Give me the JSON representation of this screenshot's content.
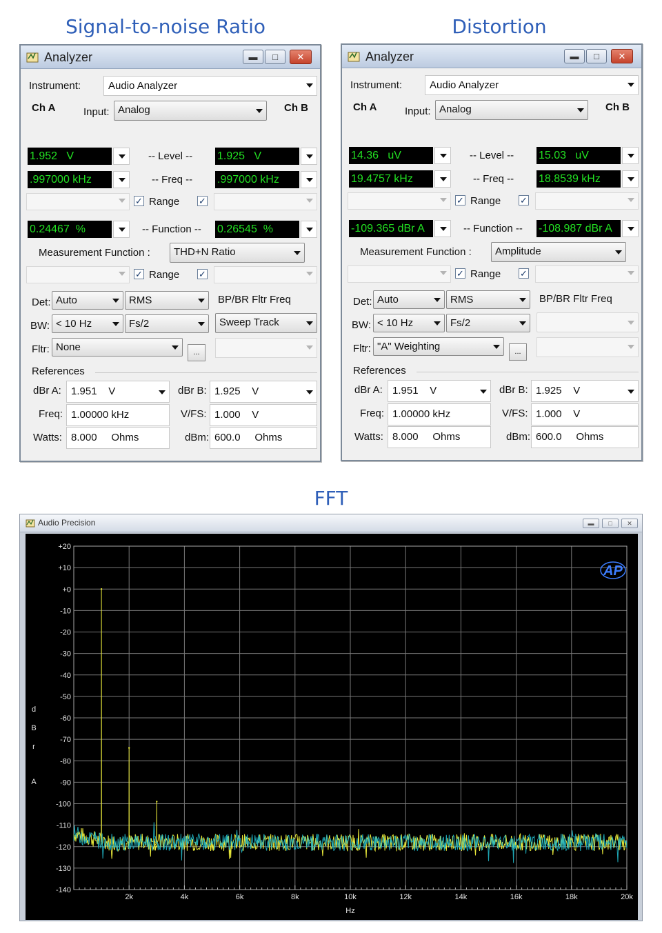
{
  "sections": {
    "snr": "Signal-to-noise Ratio",
    "distortion": "Distortion",
    "fft": "FFT"
  },
  "colors": {
    "section_title": "#2f5fb8",
    "meter_text": "#22e022",
    "meter_bg": "#000000",
    "trace_yellow": "#e8e83a",
    "trace_cyan": "#21b8c8",
    "logo": "#3c7dff"
  },
  "windows": [
    {
      "title": "Analyzer",
      "instrument_label": "Instrument:",
      "instrument_value": "Audio Analyzer",
      "ch_a": "Ch A",
      "ch_b": "Ch B",
      "input_label": "Input:",
      "input_value": "Analog",
      "level_a": "1.952   V",
      "level_label": "-- Level --",
      "level_b": "1.925   V",
      "freq_a": ".997000 kHz",
      "freq_label": "-- Freq --",
      "freq_b": ".997000 kHz",
      "range_label": "Range",
      "func_a": "0.24467  %",
      "func_label": "-- Function --",
      "func_b": "0.26545  %",
      "mf_label": "Measurement Function :",
      "mf_value": "THD+N Ratio",
      "det_label": "Det:",
      "det_value": "Auto",
      "det_value2": "RMS",
      "bp_label": "BP/BR Fltr Freq",
      "bw_label": "BW:",
      "bw_value": "< 10 Hz",
      "bw_value2": "Fs/2",
      "sweep_value": "Sweep Track",
      "fltr_label": "Fltr:",
      "fltr_value": "None",
      "ellipsis": "...",
      "references": "References",
      "dbra_label": "dBr A:",
      "dbra_value": "1.951",
      "dbra_unit": "V",
      "dbrb_label": "dBr B:",
      "dbrb_value": "1.925",
      "dbrb_unit": "V",
      "freq_ref_label": "Freq:",
      "freq_ref_value": "1.00000 kHz",
      "vfs_label": "V/FS:",
      "vfs_value": "1.000",
      "vfs_unit": "V",
      "watts_label": "Watts:",
      "watts_value": "8.000",
      "watts_unit": "Ohms",
      "dbm_label": "dBm:",
      "dbm_value": "600.0",
      "dbm_unit": "Ohms"
    },
    {
      "title": "Analyzer",
      "instrument_label": "Instrument:",
      "instrument_value": "Audio Analyzer",
      "ch_a": "Ch A",
      "ch_b": "Ch B",
      "input_label": "Input:",
      "input_value": "Analog",
      "level_a": "14.36   uV",
      "level_label": "-- Level --",
      "level_b": "15.03   uV",
      "freq_a": "19.4757 kHz",
      "freq_label": "-- Freq --",
      "freq_b": "18.8539 kHz",
      "range_label": "Range",
      "func_a": "-109.365 dBr A",
      "func_label": "-- Function --",
      "func_b": "-108.987 dBr A",
      "mf_label": "Measurement Function :",
      "mf_value": "Amplitude",
      "det_label": "Det:",
      "det_value": "Auto",
      "det_value2": "RMS",
      "bp_label": "BP/BR Fltr Freq",
      "bw_label": "BW:",
      "bw_value": "< 10 Hz",
      "bw_value2": "Fs/2",
      "sweep_value": "",
      "fltr_label": "Fltr:",
      "fltr_value": "\"A\" Weighting",
      "ellipsis": "...",
      "references": "References",
      "dbra_label": "dBr A:",
      "dbra_value": "1.951",
      "dbra_unit": "V",
      "dbrb_label": "dBr B:",
      "dbrb_value": "1.925",
      "dbrb_unit": "V",
      "freq_ref_label": "Freq:",
      "freq_ref_value": "1.00000 kHz",
      "vfs_label": "V/FS:",
      "vfs_value": "1.000",
      "vfs_unit": "V",
      "watts_label": "Watts:",
      "watts_value": "8.000",
      "watts_unit": "Ohms",
      "dbm_label": "dBm:",
      "dbm_value": "600.0",
      "dbm_unit": "Ohms"
    }
  ],
  "fft_window": {
    "title": "Audio Precision",
    "logo": "AP"
  },
  "chart_data": {
    "type": "line",
    "title": "",
    "xlabel": "Hz",
    "ylabel": "d B r   A",
    "xlim": [
      0,
      20000
    ],
    "ylim": [
      -140,
      20
    ],
    "x_ticks": [
      "2k",
      "4k",
      "6k",
      "8k",
      "10k",
      "12k",
      "14k",
      "16k",
      "18k",
      "20k"
    ],
    "y_ticks": [
      "+20",
      "+10",
      "+0",
      "-10",
      "-20",
      "-30",
      "-40",
      "-50",
      "-60",
      "-70",
      "-80",
      "-90",
      "-100",
      "-110",
      "-120",
      "-130",
      "-140"
    ],
    "grid": true,
    "noise_floor": {
      "center": -118,
      "spread": 4
    },
    "series": [
      {
        "color": "#e8e83a",
        "peaks": [
          {
            "x": 1000,
            "y": 0
          },
          {
            "x": 2000,
            "y": -74
          },
          {
            "x": 3000,
            "y": -99
          }
        ]
      },
      {
        "color": "#21b8c8",
        "peaks": []
      }
    ]
  }
}
